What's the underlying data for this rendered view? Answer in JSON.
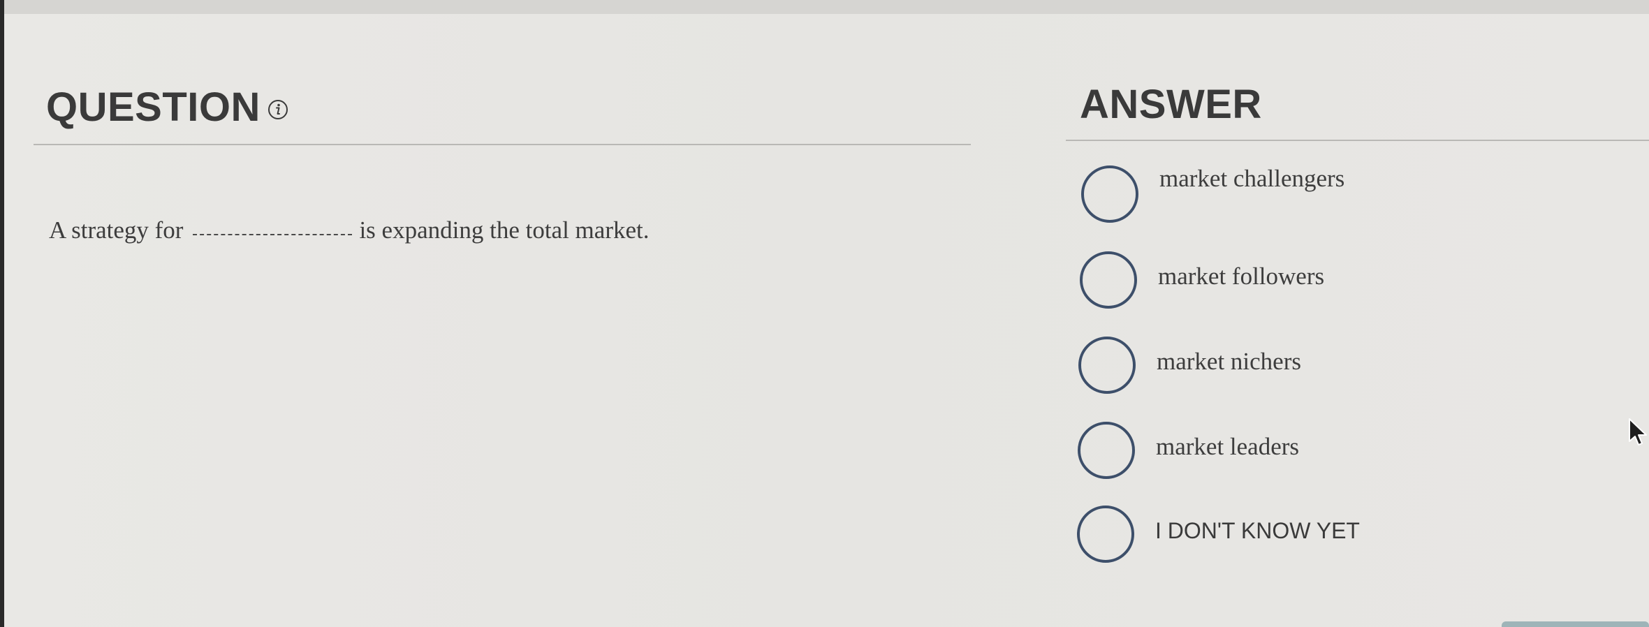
{
  "question": {
    "heading": "QUESTION",
    "info_icon": "info-icon",
    "text_before": "A strategy for",
    "text_after": "is expanding the total market."
  },
  "answer": {
    "heading": "ANSWER",
    "options": [
      {
        "label": "market challengers"
      },
      {
        "label": "market followers"
      },
      {
        "label": "market nichers"
      },
      {
        "label": "market leaders"
      },
      {
        "label": "I DON'T KNOW YET"
      }
    ]
  },
  "colors": {
    "radio_border": "#3d4f6a",
    "text": "#3d3d3d",
    "background": "#e7e6e3"
  }
}
